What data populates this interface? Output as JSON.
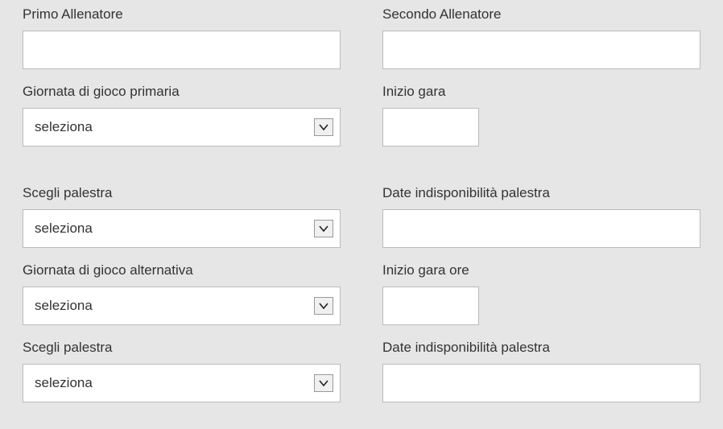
{
  "fields": {
    "primoAllenatore": {
      "label": "Primo Allenatore",
      "value": ""
    },
    "secondoAllenatore": {
      "label": "Secondo Allenatore",
      "value": ""
    },
    "giornataPrimaria": {
      "label": "Giornata di gioco primaria",
      "selected": "seleziona"
    },
    "inizioGara1": {
      "label": "Inizio gara",
      "value": ""
    },
    "scegliPalestra1": {
      "label": "Scegli palestra",
      "selected": "seleziona"
    },
    "dateIndisponibilita1": {
      "label": "Date indisponibilità palestra",
      "value": ""
    },
    "giornataAlternativa": {
      "label": "Giornata di gioco alternativa",
      "selected": "seleziona"
    },
    "inizioGaraOre": {
      "label": "Inizio gara ore",
      "value": ""
    },
    "scegliPalestra2": {
      "label": "Scegli palestra",
      "selected": "seleziona"
    },
    "dateIndisponibilita2": {
      "label": "Date indisponibilità palestra",
      "value": ""
    }
  }
}
